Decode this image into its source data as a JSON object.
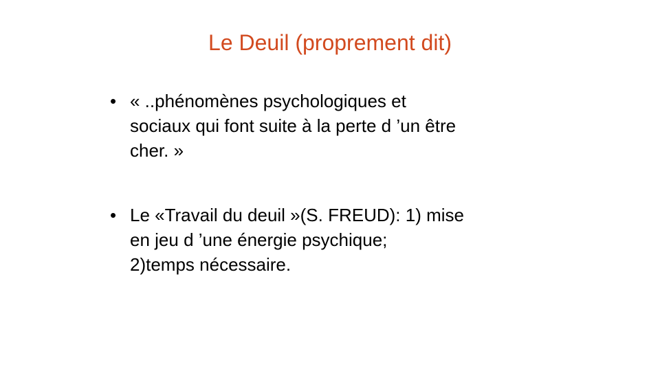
{
  "slide": {
    "title": "Le Deuil (proprement dit)",
    "title_color": "#d24a1f",
    "bullet_glyph": "•",
    "bullets": [
      {
        "lines": [
          "« ..phénomènes psychologiques  et",
          "sociaux qui font suite à la perte d ’un être",
          "cher. »"
        ]
      },
      {
        "lines": [
          "Le «Travail du deuil »(S. FREUD): 1) mise",
          "en jeu d ’une énergie psychique;",
          "2)temps nécessaire."
        ]
      }
    ]
  }
}
